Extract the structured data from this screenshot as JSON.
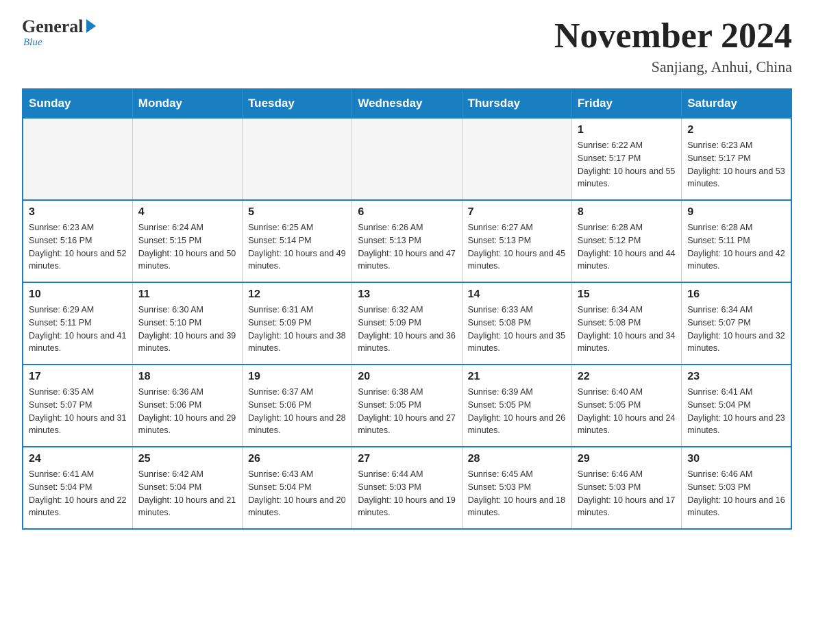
{
  "header": {
    "logo_general": "General",
    "logo_blue": "Blue",
    "logo_tagline": "Blue",
    "month_title": "November 2024",
    "location": "Sanjiang, Anhui, China"
  },
  "days_of_week": [
    "Sunday",
    "Monday",
    "Tuesday",
    "Wednesday",
    "Thursday",
    "Friday",
    "Saturday"
  ],
  "weeks": [
    [
      {
        "day": "",
        "sunrise": "",
        "sunset": "",
        "daylight": "",
        "empty": true
      },
      {
        "day": "",
        "sunrise": "",
        "sunset": "",
        "daylight": "",
        "empty": true
      },
      {
        "day": "",
        "sunrise": "",
        "sunset": "",
        "daylight": "",
        "empty": true
      },
      {
        "day": "",
        "sunrise": "",
        "sunset": "",
        "daylight": "",
        "empty": true
      },
      {
        "day": "",
        "sunrise": "",
        "sunset": "",
        "daylight": "",
        "empty": true
      },
      {
        "day": "1",
        "sunrise": "Sunrise: 6:22 AM",
        "sunset": "Sunset: 5:17 PM",
        "daylight": "Daylight: 10 hours and 55 minutes.",
        "empty": false
      },
      {
        "day": "2",
        "sunrise": "Sunrise: 6:23 AM",
        "sunset": "Sunset: 5:17 PM",
        "daylight": "Daylight: 10 hours and 53 minutes.",
        "empty": false
      }
    ],
    [
      {
        "day": "3",
        "sunrise": "Sunrise: 6:23 AM",
        "sunset": "Sunset: 5:16 PM",
        "daylight": "Daylight: 10 hours and 52 minutes.",
        "empty": false
      },
      {
        "day": "4",
        "sunrise": "Sunrise: 6:24 AM",
        "sunset": "Sunset: 5:15 PM",
        "daylight": "Daylight: 10 hours and 50 minutes.",
        "empty": false
      },
      {
        "day": "5",
        "sunrise": "Sunrise: 6:25 AM",
        "sunset": "Sunset: 5:14 PM",
        "daylight": "Daylight: 10 hours and 49 minutes.",
        "empty": false
      },
      {
        "day": "6",
        "sunrise": "Sunrise: 6:26 AM",
        "sunset": "Sunset: 5:13 PM",
        "daylight": "Daylight: 10 hours and 47 minutes.",
        "empty": false
      },
      {
        "day": "7",
        "sunrise": "Sunrise: 6:27 AM",
        "sunset": "Sunset: 5:13 PM",
        "daylight": "Daylight: 10 hours and 45 minutes.",
        "empty": false
      },
      {
        "day": "8",
        "sunrise": "Sunrise: 6:28 AM",
        "sunset": "Sunset: 5:12 PM",
        "daylight": "Daylight: 10 hours and 44 minutes.",
        "empty": false
      },
      {
        "day": "9",
        "sunrise": "Sunrise: 6:28 AM",
        "sunset": "Sunset: 5:11 PM",
        "daylight": "Daylight: 10 hours and 42 minutes.",
        "empty": false
      }
    ],
    [
      {
        "day": "10",
        "sunrise": "Sunrise: 6:29 AM",
        "sunset": "Sunset: 5:11 PM",
        "daylight": "Daylight: 10 hours and 41 minutes.",
        "empty": false
      },
      {
        "day": "11",
        "sunrise": "Sunrise: 6:30 AM",
        "sunset": "Sunset: 5:10 PM",
        "daylight": "Daylight: 10 hours and 39 minutes.",
        "empty": false
      },
      {
        "day": "12",
        "sunrise": "Sunrise: 6:31 AM",
        "sunset": "Sunset: 5:09 PM",
        "daylight": "Daylight: 10 hours and 38 minutes.",
        "empty": false
      },
      {
        "day": "13",
        "sunrise": "Sunrise: 6:32 AM",
        "sunset": "Sunset: 5:09 PM",
        "daylight": "Daylight: 10 hours and 36 minutes.",
        "empty": false
      },
      {
        "day": "14",
        "sunrise": "Sunrise: 6:33 AM",
        "sunset": "Sunset: 5:08 PM",
        "daylight": "Daylight: 10 hours and 35 minutes.",
        "empty": false
      },
      {
        "day": "15",
        "sunrise": "Sunrise: 6:34 AM",
        "sunset": "Sunset: 5:08 PM",
        "daylight": "Daylight: 10 hours and 34 minutes.",
        "empty": false
      },
      {
        "day": "16",
        "sunrise": "Sunrise: 6:34 AM",
        "sunset": "Sunset: 5:07 PM",
        "daylight": "Daylight: 10 hours and 32 minutes.",
        "empty": false
      }
    ],
    [
      {
        "day": "17",
        "sunrise": "Sunrise: 6:35 AM",
        "sunset": "Sunset: 5:07 PM",
        "daylight": "Daylight: 10 hours and 31 minutes.",
        "empty": false
      },
      {
        "day": "18",
        "sunrise": "Sunrise: 6:36 AM",
        "sunset": "Sunset: 5:06 PM",
        "daylight": "Daylight: 10 hours and 29 minutes.",
        "empty": false
      },
      {
        "day": "19",
        "sunrise": "Sunrise: 6:37 AM",
        "sunset": "Sunset: 5:06 PM",
        "daylight": "Daylight: 10 hours and 28 minutes.",
        "empty": false
      },
      {
        "day": "20",
        "sunrise": "Sunrise: 6:38 AM",
        "sunset": "Sunset: 5:05 PM",
        "daylight": "Daylight: 10 hours and 27 minutes.",
        "empty": false
      },
      {
        "day": "21",
        "sunrise": "Sunrise: 6:39 AM",
        "sunset": "Sunset: 5:05 PM",
        "daylight": "Daylight: 10 hours and 26 minutes.",
        "empty": false
      },
      {
        "day": "22",
        "sunrise": "Sunrise: 6:40 AM",
        "sunset": "Sunset: 5:05 PM",
        "daylight": "Daylight: 10 hours and 24 minutes.",
        "empty": false
      },
      {
        "day": "23",
        "sunrise": "Sunrise: 6:41 AM",
        "sunset": "Sunset: 5:04 PM",
        "daylight": "Daylight: 10 hours and 23 minutes.",
        "empty": false
      }
    ],
    [
      {
        "day": "24",
        "sunrise": "Sunrise: 6:41 AM",
        "sunset": "Sunset: 5:04 PM",
        "daylight": "Daylight: 10 hours and 22 minutes.",
        "empty": false
      },
      {
        "day": "25",
        "sunrise": "Sunrise: 6:42 AM",
        "sunset": "Sunset: 5:04 PM",
        "daylight": "Daylight: 10 hours and 21 minutes.",
        "empty": false
      },
      {
        "day": "26",
        "sunrise": "Sunrise: 6:43 AM",
        "sunset": "Sunset: 5:04 PM",
        "daylight": "Daylight: 10 hours and 20 minutes.",
        "empty": false
      },
      {
        "day": "27",
        "sunrise": "Sunrise: 6:44 AM",
        "sunset": "Sunset: 5:03 PM",
        "daylight": "Daylight: 10 hours and 19 minutes.",
        "empty": false
      },
      {
        "day": "28",
        "sunrise": "Sunrise: 6:45 AM",
        "sunset": "Sunset: 5:03 PM",
        "daylight": "Daylight: 10 hours and 18 minutes.",
        "empty": false
      },
      {
        "day": "29",
        "sunrise": "Sunrise: 6:46 AM",
        "sunset": "Sunset: 5:03 PM",
        "daylight": "Daylight: 10 hours and 17 minutes.",
        "empty": false
      },
      {
        "day": "30",
        "sunrise": "Sunrise: 6:46 AM",
        "sunset": "Sunset: 5:03 PM",
        "daylight": "Daylight: 10 hours and 16 minutes.",
        "empty": false
      }
    ]
  ]
}
